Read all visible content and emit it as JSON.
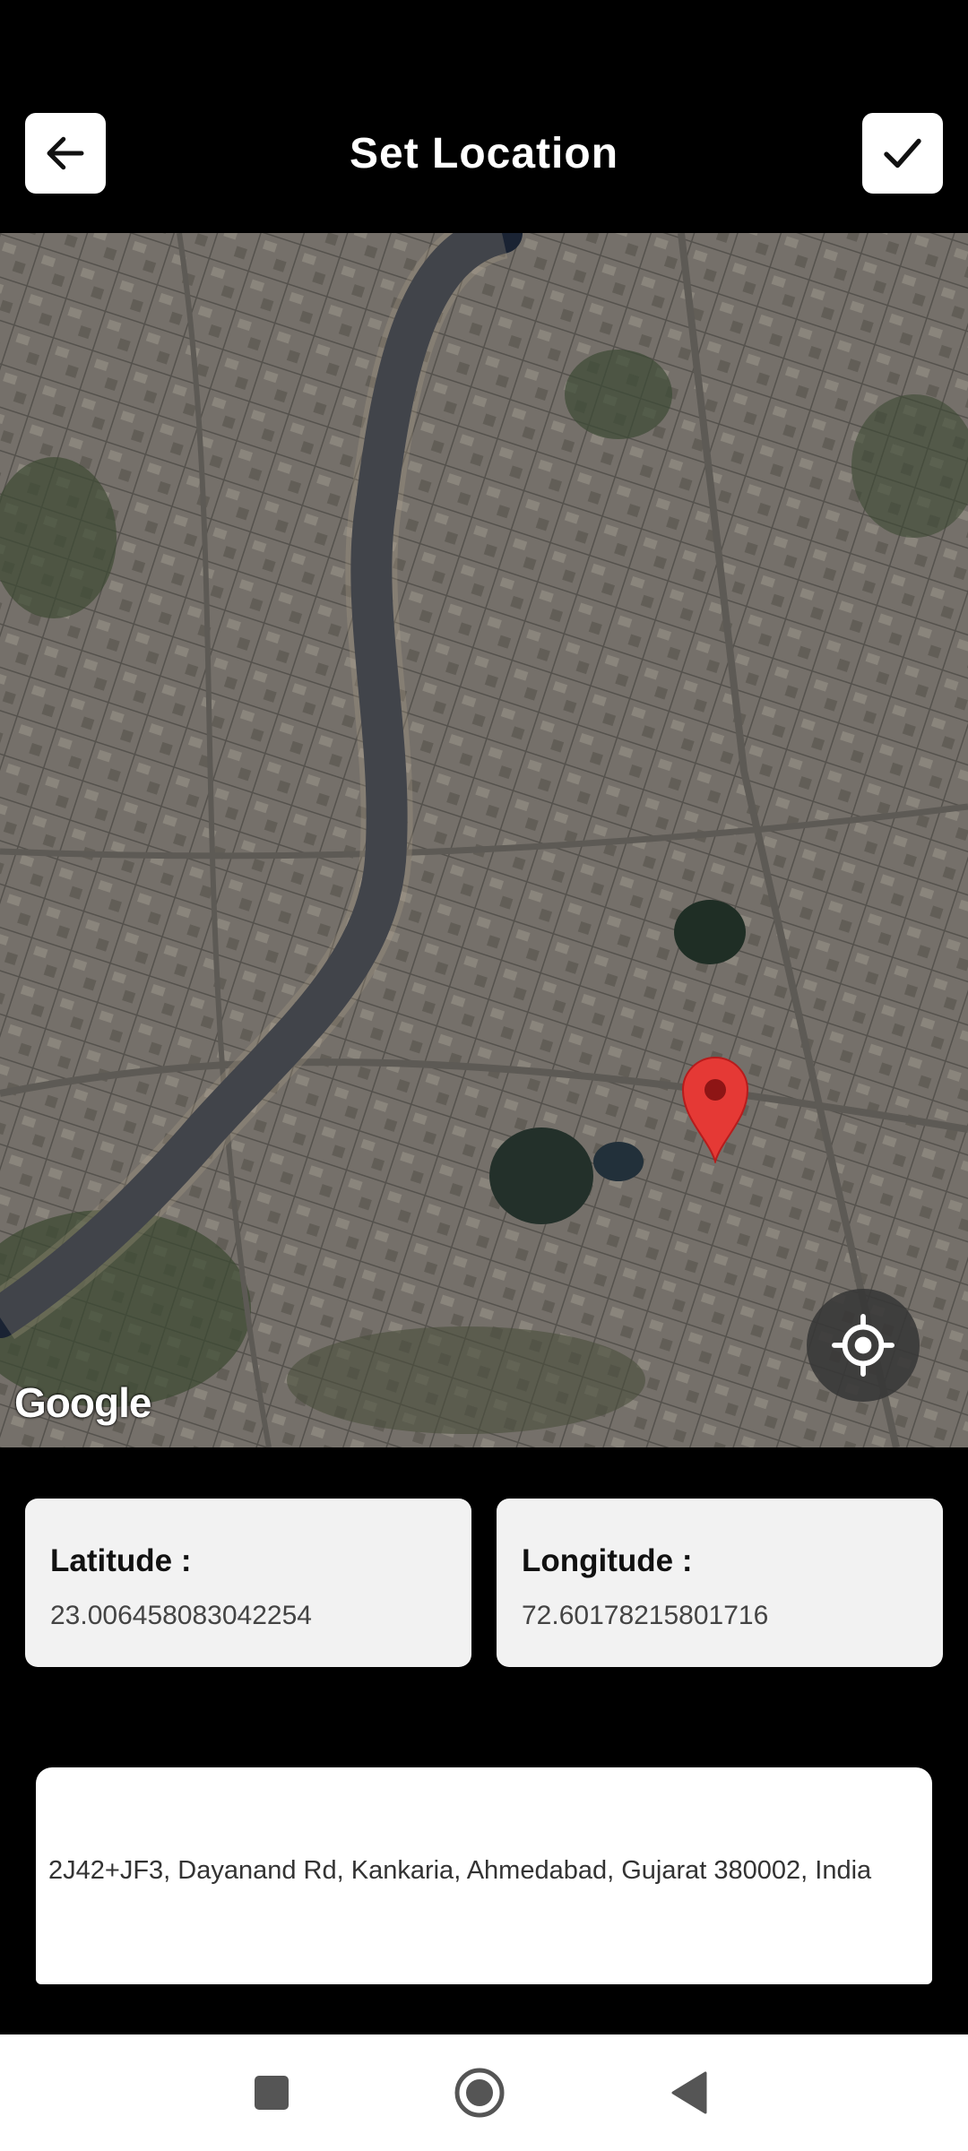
{
  "header": {
    "title": "Set Location",
    "back_icon": "arrow-left-icon",
    "confirm_icon": "check-icon"
  },
  "map": {
    "attribution": "Google",
    "my_location_icon": "crosshair-icon",
    "pin_icon": "map-pin-icon",
    "pin_color": "#e53935"
  },
  "coordinates": {
    "latitude_label": "Latitude :",
    "latitude_value": "23.006458083042254",
    "longitude_label": "Longitude :",
    "longitude_value": "72.60178215801716"
  },
  "address": {
    "text": "2J42+JF3, Dayanand Rd, Kankaria, Ahmedabad, Gujarat 380002, India"
  },
  "nav": {
    "recents_icon": "square-icon",
    "home_icon": "circle-icon",
    "back_icon": "triangle-back-icon"
  }
}
